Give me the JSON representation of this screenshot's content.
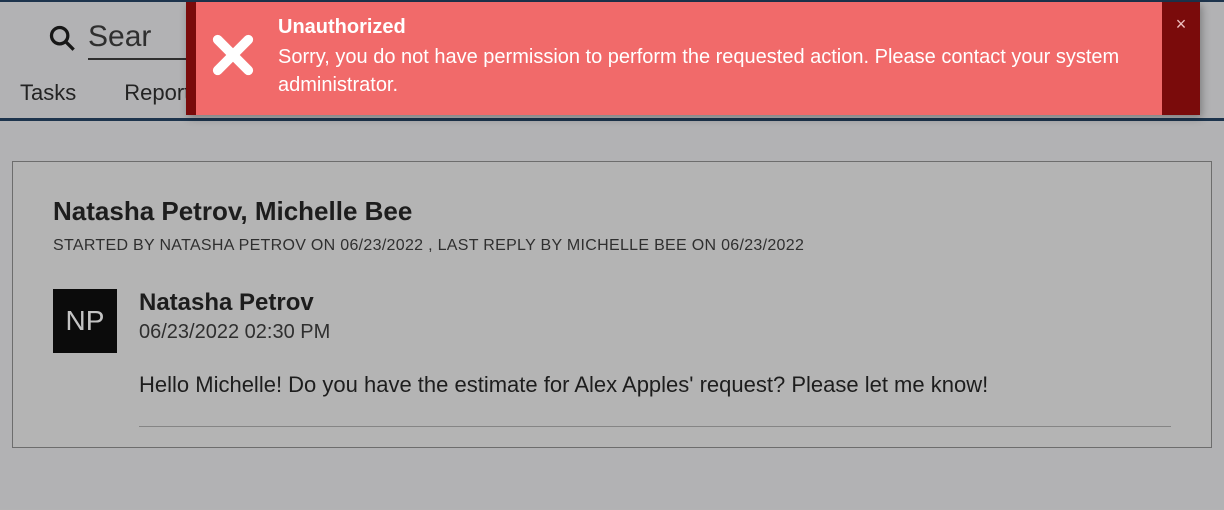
{
  "search": {
    "placeholder": "Sear"
  },
  "tabs": {
    "tasks": "Tasks",
    "reports": "Reports"
  },
  "thread": {
    "title": "Natasha Petrov, Michelle Bee",
    "meta": "STARTED BY NATASHA PETROV ON 06/23/2022 , LAST REPLY BY MICHELLE BEE ON 06/23/2022",
    "message": {
      "avatar_initials": "NP",
      "author": "Natasha Petrov",
      "timestamp": "06/23/2022 02:30 PM",
      "body": "Hello Michelle! Do you have the estimate for Alex Apples' request? Please let me know!"
    }
  },
  "alert": {
    "title": "Unauthorized",
    "message": "Sorry, you do not have permission to perform the requested action. Please contact your system administrator.",
    "close_label": "×"
  }
}
